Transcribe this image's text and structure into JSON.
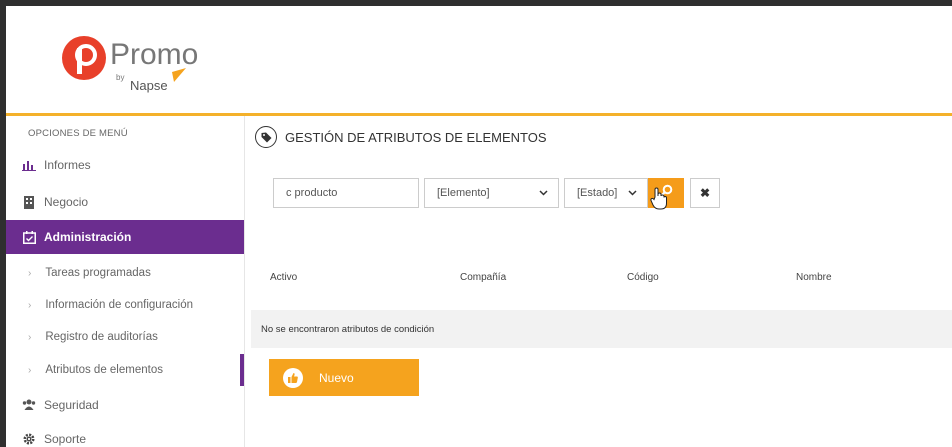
{
  "brand": {
    "name": "Promo",
    "by": "by",
    "company": "Napse",
    "logo_letter": "p"
  },
  "sidebar": {
    "section_title": "OPCIONES DE MENÚ",
    "items": [
      {
        "label": "Informes",
        "icon": "bar-chart-icon"
      },
      {
        "label": "Negocio",
        "icon": "building-icon"
      },
      {
        "label": "Administración",
        "icon": "calendar-check-icon",
        "active": true
      }
    ],
    "sub_items": [
      {
        "label": "Tareas programadas"
      },
      {
        "label": "Información de configuración"
      },
      {
        "label": "Registro de auditorías"
      },
      {
        "label": "Atributos de elementos",
        "current": true
      }
    ],
    "bottom_items": [
      {
        "label": "Seguridad",
        "icon": "users-icon"
      },
      {
        "label": "Soporte",
        "icon": "gear-icon"
      }
    ]
  },
  "page": {
    "title": "GESTIÓN DE ATRIBUTOS DE ELEMENTOS",
    "filters": {
      "search_value": "c producto",
      "elemento_value": "[Elemento]",
      "estado_value": "[Estado]"
    },
    "table": {
      "columns": [
        "Activo",
        "Compañía",
        "Código",
        "Nombre"
      ],
      "empty_message": "No se encontraron atributos de condición"
    },
    "new_button": "Nuevo"
  },
  "colors": {
    "accent": "#f5a31e",
    "brand_purple": "#6b2d8f",
    "logo_red": "#e8402a"
  }
}
